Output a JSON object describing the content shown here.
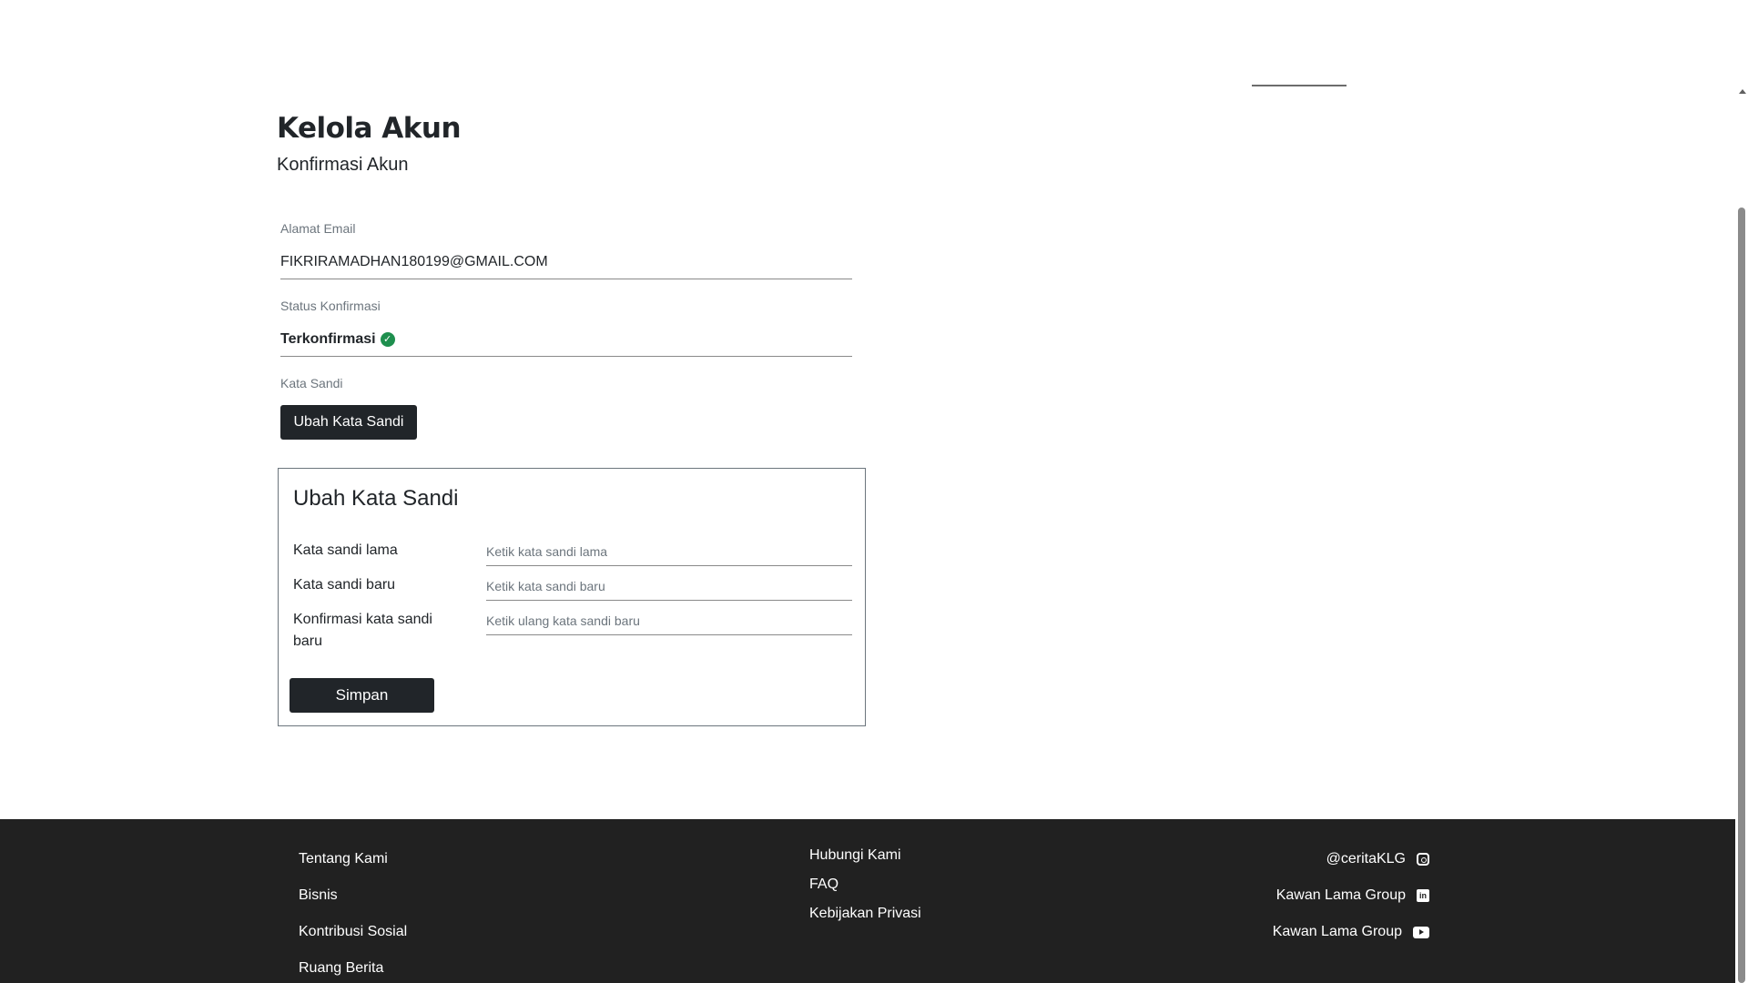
{
  "header": {
    "title": "Kelola Akun",
    "subtitle": "Konfirmasi Akun"
  },
  "account": {
    "email_label": "Alamat Email",
    "email_value": "FIKRIRAMADHAN180199@GMAIL.COM",
    "status_label": "Status Konfirmasi",
    "status_value": "Terkonfirmasi",
    "status_icon": "check-circle-icon",
    "status_color": "#1e8f4e",
    "password_label": "Kata Sandi",
    "change_password_button": "Ubah Kata Sandi"
  },
  "change_password": {
    "title": "Ubah Kata Sandi",
    "old_label": "Kata sandi lama",
    "old_placeholder": "Ketik kata sandi lama",
    "new_label": "Kata sandi baru",
    "new_placeholder": "Ketik kata sandi baru",
    "confirm_label": "Konfirmasi kata sandi baru",
    "confirm_placeholder": "Ketik ulang kata sandi baru",
    "save_button": "Simpan"
  },
  "footer": {
    "col1": [
      "Tentang Kami",
      "Bisnis",
      "Kontribusi Sosial",
      "Ruang Berita"
    ],
    "col2": [
      "Hubungi Kami",
      "FAQ",
      "Kebijakan Privasi"
    ],
    "social": [
      {
        "label": "@ceritaKLG",
        "icon": "instagram-icon"
      },
      {
        "label": "Kawan Lama Group",
        "icon": "linkedin-icon"
      },
      {
        "label": "Kawan Lama Group",
        "icon": "youtube-icon"
      }
    ],
    "background": "#212121"
  },
  "colors": {
    "primary_button": "#212529"
  }
}
